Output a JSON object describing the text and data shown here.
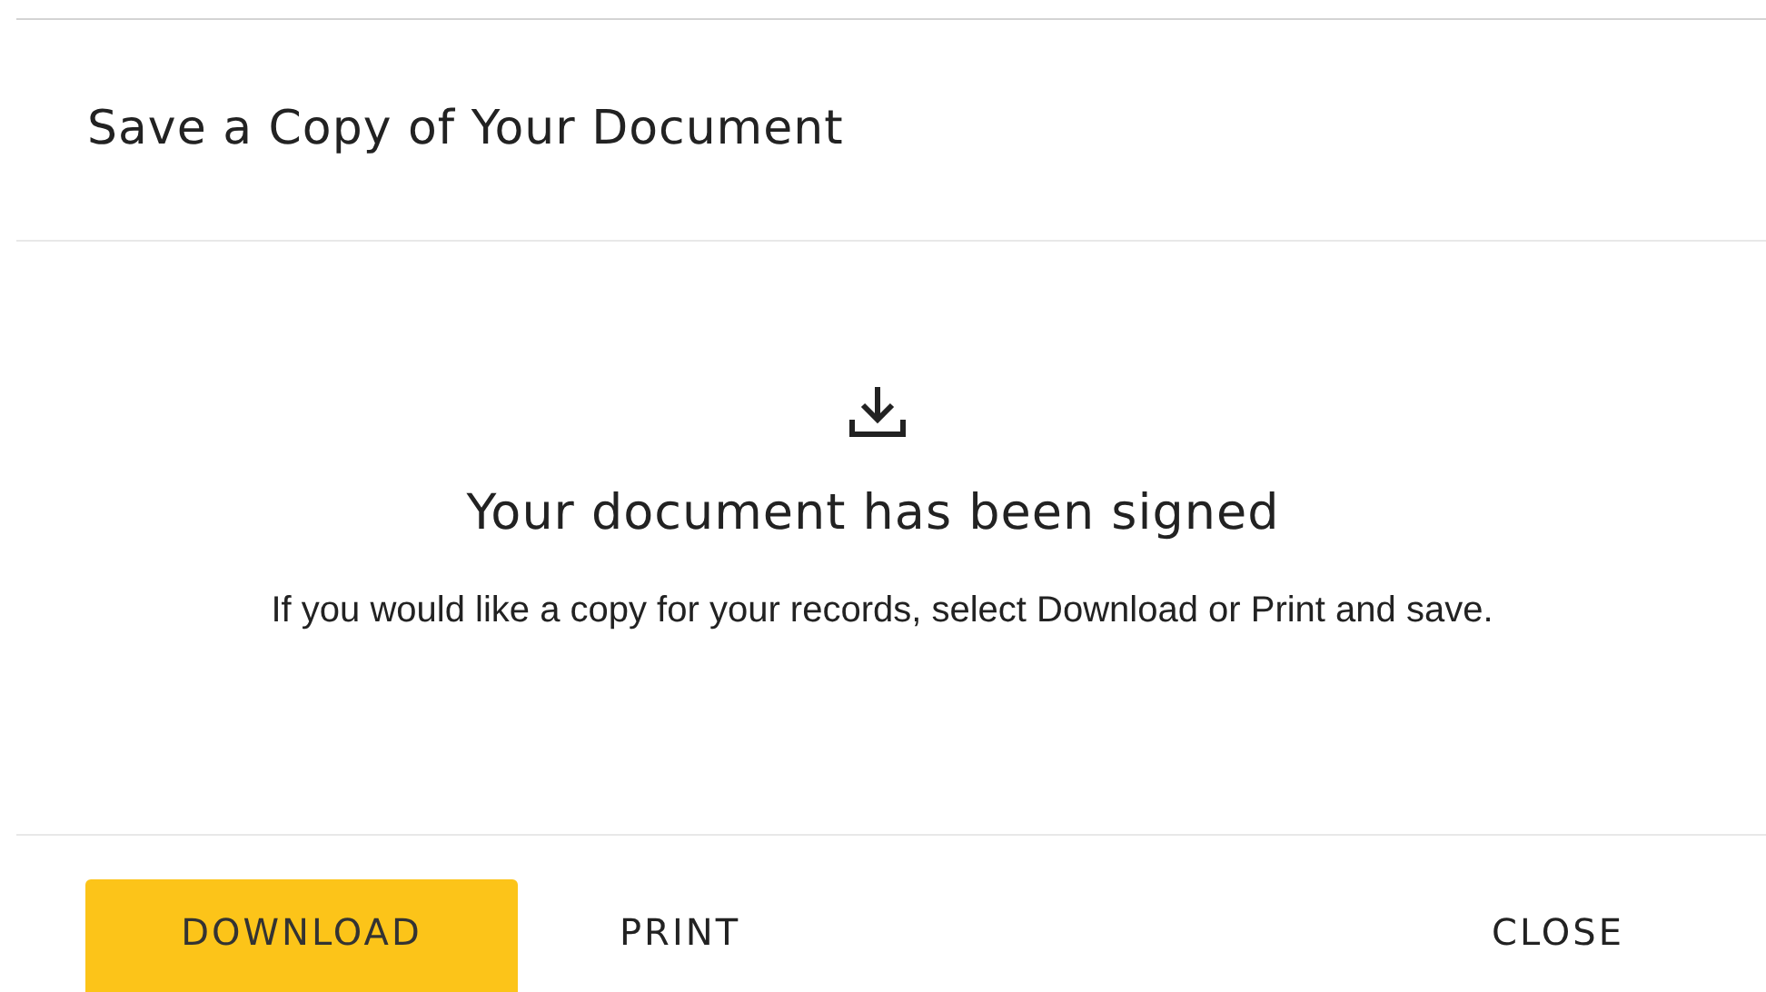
{
  "dialog": {
    "title": "Save a Copy of Your Document",
    "heading": "Your document has been signed",
    "message": "If you would like a copy for your records, select Download or Print and save."
  },
  "buttons": [
    {
      "label": "DOWNLOAD",
      "kind": "primary"
    },
    {
      "label": "PRINT",
      "kind": "text"
    },
    {
      "label": "CLOSE",
      "kind": "close"
    }
  ]
}
